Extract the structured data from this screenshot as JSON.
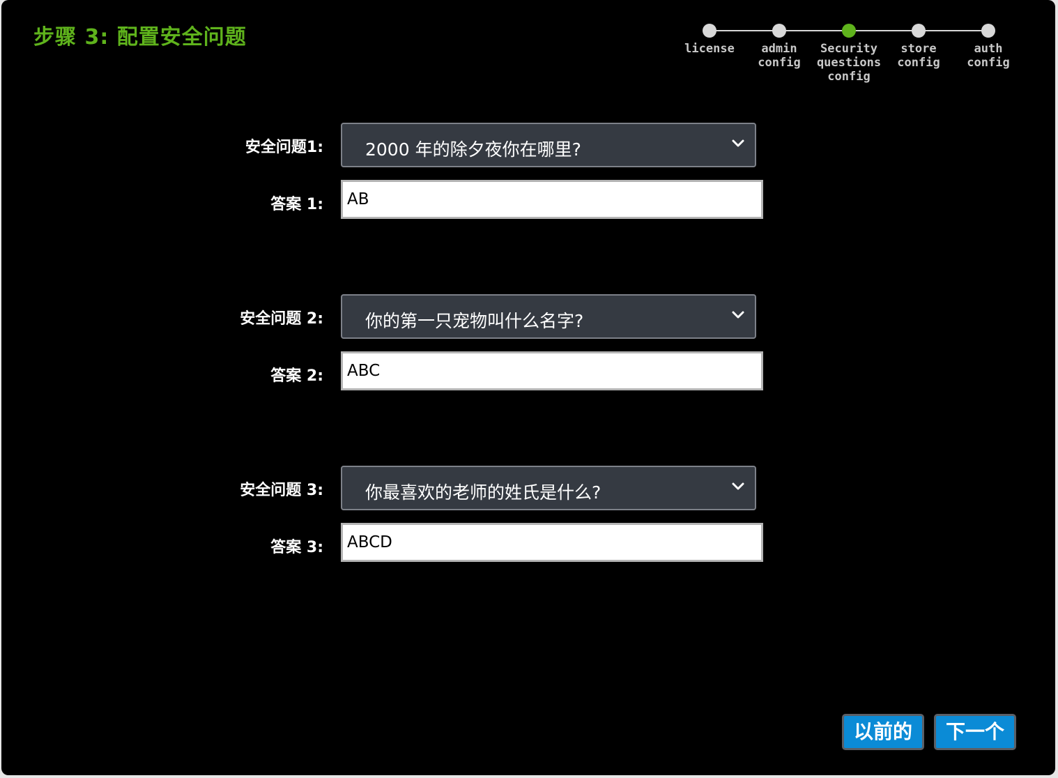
{
  "header": {
    "title": "步骤 3: 配置安全问题"
  },
  "tracker": {
    "steps": [
      {
        "label": "license",
        "active": false
      },
      {
        "label": "admin config",
        "active": false
      },
      {
        "label": "Security questions config",
        "active": true
      },
      {
        "label": "store config",
        "active": false
      },
      {
        "label": "auth config",
        "active": false
      }
    ],
    "colors": {
      "active": "#5fb31c",
      "inactive": "#d8d8d8"
    }
  },
  "form": {
    "questions": [
      {
        "label": "安全问题1:",
        "selected": "2000 年的除夕夜你在哪里?",
        "answer_label": "答案 1:",
        "answer": "AB"
      },
      {
        "label": "安全问题 2:",
        "selected": "你的第一只宠物叫什么名字?",
        "answer_label": "答案 2:",
        "answer": "ABC"
      },
      {
        "label": "安全问题 3:",
        "selected": "你最喜欢的老师的姓氏是什么?",
        "answer_label": "答案 3:",
        "answer": "ABCD"
      }
    ]
  },
  "buttons": {
    "previous": "以前的",
    "next": "下一个"
  },
  "icons": {
    "dropdown": "chevron-down-icon"
  }
}
